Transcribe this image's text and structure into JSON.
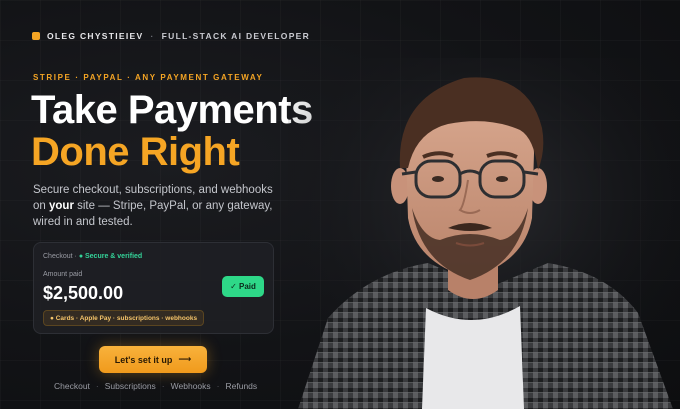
{
  "brand": {
    "name": "OLEG CHYSTIEIEV",
    "separator": "·",
    "role": "FULL-STACK AI DEVELOPER"
  },
  "hero": {
    "eyebrow": "STRIPE · PAYPAL · ANY PAYMENT GATEWAY",
    "headline_line1": "Take Payments",
    "headline_line2": "Done Right",
    "sub_part1": "Secure checkout, subscriptions, and webhooks on ",
    "sub_emphasis": "your",
    "sub_part2": " site — Stripe, PayPal, or any gateway, wired in and tested."
  },
  "checkout_card": {
    "label": "Checkout ·",
    "secure": "● Secure & verified",
    "amount_label": "Amount paid",
    "amount": "$2,500.00",
    "status": "✓ Paid",
    "features": "● Cards · Apple Pay · subscriptions · webhooks"
  },
  "cta": {
    "label": "Let's set it up",
    "arrow": "⟶"
  },
  "footer_links": [
    "Checkout",
    "Subscriptions",
    "Webhooks",
    "Refunds"
  ],
  "footer_separator": "·",
  "colors": {
    "accent": "#f5a524",
    "success": "#2ed888",
    "background": "#121316"
  },
  "icons": [
    "brand-mark-icon",
    "arrow-right-icon",
    "check-icon"
  ]
}
